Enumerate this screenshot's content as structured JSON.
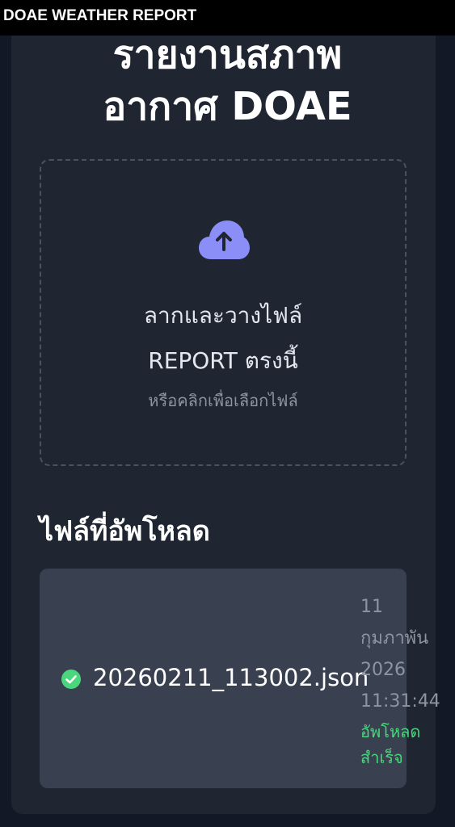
{
  "window": {
    "title": "DOAE WEATHER REPORT"
  },
  "header": {
    "title_line1": "รายงานสภาพ",
    "title_line2": "อากาศ DOAE"
  },
  "dropzone": {
    "icon": "cloud-upload-icon",
    "main_line1": "ลากและวางไฟล์",
    "main_line2": "REPORT ตรงนี้",
    "sub": "หรือคลิกเพื่อเลือกไฟล์"
  },
  "uploads": {
    "title": "ไฟล์ที่อัพโหลด",
    "files": [
      {
        "status_icon": "check-circle-icon",
        "name": "20260211_113002.json",
        "date_lines": [
          "11",
          "กุมภาพัน",
          "2026",
          "11:31:44"
        ],
        "status": "อัพโหลดสำเร็จ"
      }
    ]
  },
  "colors": {
    "background": "#121826",
    "card": "#1f2632",
    "file_row": "#394150",
    "accent": "#8b8ef7",
    "success": "#4ad67c"
  }
}
